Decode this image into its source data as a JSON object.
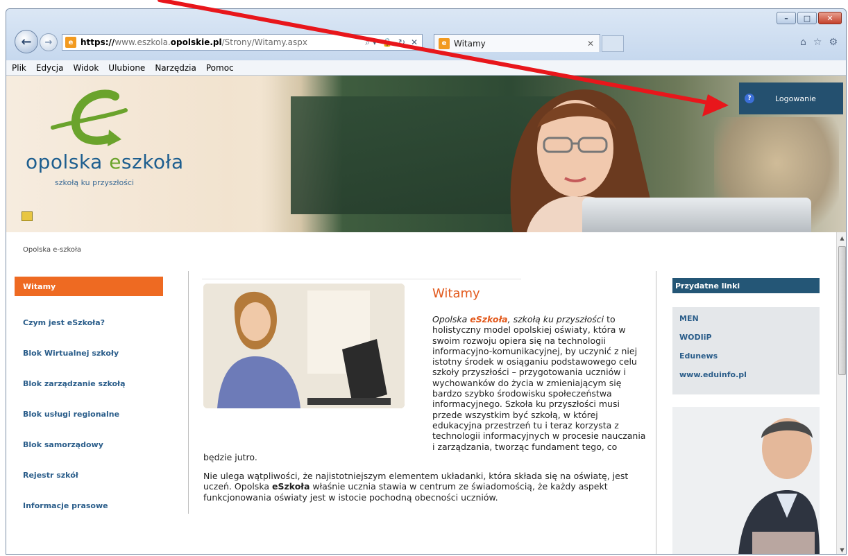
{
  "window": {
    "controls": {
      "minimize": "–",
      "maximize": "□",
      "close": "✕"
    }
  },
  "browser": {
    "back_icon": "arrow-left",
    "forward_icon": "arrow-right",
    "address": {
      "prefix": "https://",
      "host_dim": "www.eszkola.",
      "host_bold": "opolskie.pl",
      "path": "/Strony/Witamy.aspx",
      "tools": [
        "⌕ ▾",
        "🔒",
        "↻",
        "✕"
      ]
    },
    "tab": {
      "title": "Witamy",
      "close": "✕"
    },
    "icons": [
      "⌂",
      "☆",
      "⚙"
    ],
    "menu": [
      "Plik",
      "Edycja",
      "Widok",
      "Ulubione",
      "Narzędzia",
      "Pomoc"
    ]
  },
  "banner": {
    "logo_text_a": "opolska ",
    "logo_text_b": "e",
    "logo_text_c": "szkoła",
    "tagline": "szkołą ku przyszłości",
    "login_label": "Logowanie",
    "login_icon": "?"
  },
  "breadcrumb": "Opolska e-szkoła",
  "leftnav": {
    "items": [
      {
        "label": "Witamy",
        "active": true
      },
      {
        "label": "Czym jest eSzkoła?"
      },
      {
        "label": "Blok Wirtualnej szkoły"
      },
      {
        "label": "Blok zarządzanie szkołą"
      },
      {
        "label": "Blok usługi regionalne"
      },
      {
        "label": "Blok samorządowy"
      },
      {
        "label": "Rejestr szkół"
      },
      {
        "label": "Informacje prasowe"
      }
    ]
  },
  "content": {
    "title": "Witamy",
    "p1_part1": "Opolska ",
    "p1_brand": "eSzkoła",
    "p1_part2": ", szkołą ku przyszłości",
    "p1_rest": " to holistyczny model opolskiej oświaty, która w swoim rozwoju opiera się na technologii informacyjno-komunikacyjnej, by uczynić z niej istotny środek w osiąganiu podstawowego celu szkoły przyszłości – przygotowania uczniów i wychowanków do życia w zmieniającym się bardzo szybko środowisku społeczeństwa informacyjnego. Szkoła ku przyszłości musi przede wszystkim być szkołą, w której edukacyjna przestrzeń tu i teraz korzysta z technologii informacyjnych w procesie nauczania i zarządzania, tworząc fundament tego, co będzie jutro.",
    "p2_part1": "Nie ulega wątpliwości, że najistotniejszym elementem układanki, która składa się na oświatę, jest uczeń. Opolska ",
    "p2_brand": "eSzkoła",
    "p2_part2": " właśnie ucznia stawia w centrum ze świadomością, że każdy aspekt funkcjonowania oświaty jest w istocie pochodną obecności uczniów."
  },
  "right": {
    "header": "Przydatne linki",
    "links": [
      "MEN",
      "WODIiP",
      "Edunews",
      "www.eduinfo.pl"
    ]
  },
  "colors": {
    "accent_orange": "#ee6a22",
    "title_orange": "#e2591c",
    "navy": "#245676",
    "link_blue": "#2a5d8a",
    "annotation_red": "#e8161b"
  }
}
